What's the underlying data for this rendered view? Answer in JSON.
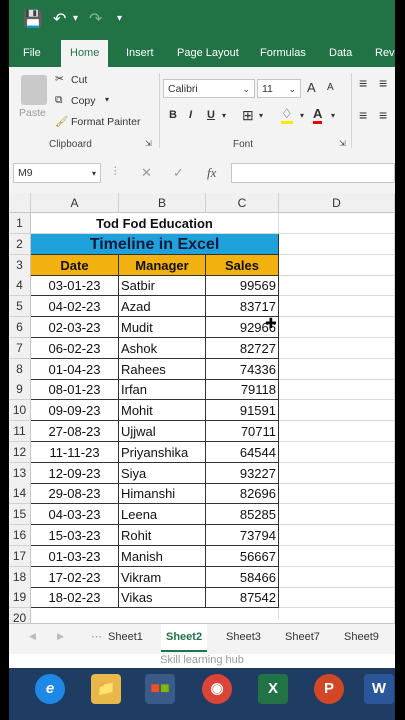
{
  "ribbon_tabs": [
    "File",
    "Home",
    "Insert",
    "Page Layout",
    "Formulas",
    "Data",
    "Revi"
  ],
  "clipboard": {
    "paste": "Paste",
    "cut": "Cut",
    "copy": "Copy",
    "format_painter": "Format Painter",
    "label": "Clipboard"
  },
  "font": {
    "name": "Calibri",
    "size": "11",
    "label": "Font",
    "grow": "A",
    "shrink": "A",
    "bold": "B",
    "italic": "I",
    "underline": "U"
  },
  "name_box": "M9",
  "fx": "fx",
  "columns": [
    "A",
    "B",
    "C",
    "D"
  ],
  "row_numbers": [
    "1",
    "2",
    "3",
    "4",
    "5",
    "6",
    "7",
    "8",
    "9",
    "10",
    "11",
    "12",
    "13",
    "14",
    "15",
    "16",
    "17",
    "18",
    "19",
    "20"
  ],
  "sheet_title": "Tod Fod Education",
  "banner": "Timeline in Excel",
  "headers": [
    "Date",
    "Manager",
    "Sales"
  ],
  "rows": [
    [
      "03-01-23",
      "Satbir",
      "99569"
    ],
    [
      "04-02-23",
      "Azad",
      "83717"
    ],
    [
      "02-03-23",
      "Mudit",
      "92966"
    ],
    [
      "06-02-23",
      "Ashok",
      "82727"
    ],
    [
      "01-04-23",
      "Rahees",
      "74336"
    ],
    [
      "08-01-23",
      "Irfan",
      "79118"
    ],
    [
      "09-09-23",
      "Mohit",
      "91591"
    ],
    [
      "27-08-23",
      "Ujjwal",
      "70711"
    ],
    [
      "11-11-23",
      "Priyanshika",
      "64544"
    ],
    [
      "12-09-23",
      "Siya",
      "93227"
    ],
    [
      "29-08-23",
      "Himanshi",
      "82696"
    ],
    [
      "04-03-23",
      "Leena",
      "85285"
    ],
    [
      "15-03-23",
      "Rohit",
      "73794"
    ],
    [
      "01-03-23",
      "Manish",
      "56667"
    ],
    [
      "17-02-23",
      "Vikram",
      "58466"
    ],
    [
      "18-02-23",
      "Vikas",
      "87542"
    ]
  ],
  "sheet_tabs": [
    "Sheet1",
    "Sheet2",
    "Sheet3",
    "Sheet7",
    "Sheet9"
  ],
  "active_sheet": "Sheet2",
  "watermark": "Skill learning hub",
  "colors": {
    "excel_green": "#217346",
    "banner_fill": "#1fa2dc",
    "header_fill": "#f2b10f",
    "taskbar": "#1f3c63"
  }
}
